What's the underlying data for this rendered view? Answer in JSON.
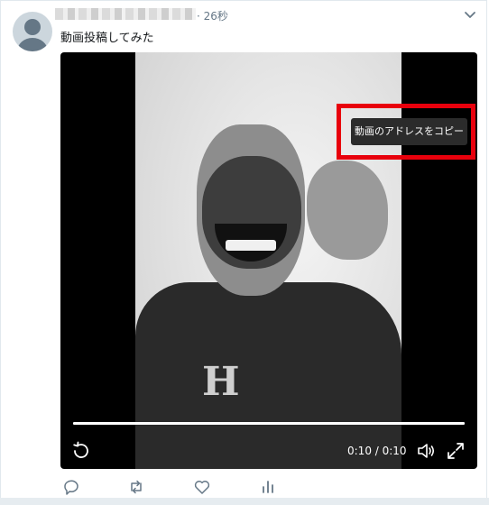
{
  "tweet": {
    "timestamp": "· 26秒",
    "text": "動画投稿してみた"
  },
  "video": {
    "context_menu_item": "動画のアドレスをコピー",
    "time_display": "0:10 / 0:10",
    "progress": 1.0,
    "logo_glyph": "H"
  },
  "icons": {
    "avatar": "default-avatar-icon",
    "menu": "chevron-down-icon",
    "replay": "replay-icon",
    "volume": "volume-icon",
    "fullscreen": "fullscreen-icon",
    "reply": "reply-icon",
    "retweet": "retweet-icon",
    "like": "heart-icon",
    "analytics": "analytics-icon"
  },
  "colors": {
    "highlight": "#e8000c",
    "secondary_text": "#657786"
  }
}
